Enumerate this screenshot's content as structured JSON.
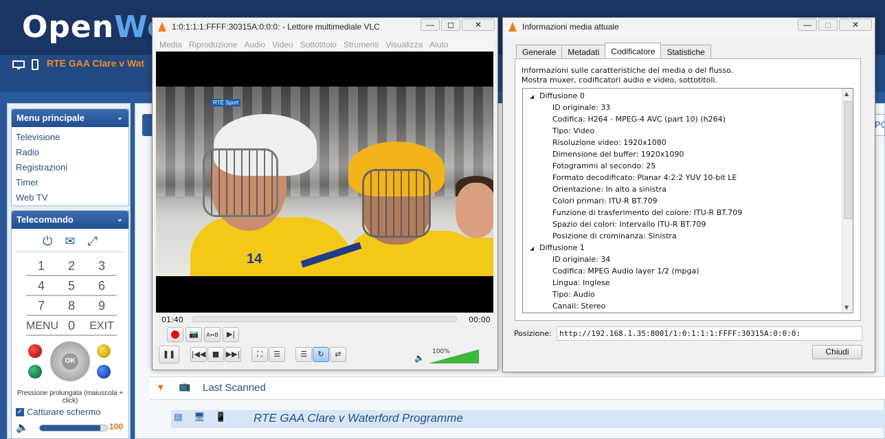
{
  "openwebif": {
    "logo_a": "Open",
    "logo_b": "We",
    "now_playing": "RTE GAA Clare v Wat",
    "menu_title": "Menu principale",
    "menu_items": [
      "Televisione",
      "Radio",
      "Registrazioni",
      "Timer",
      "Web TV"
    ],
    "remote_title": "Telecomando",
    "keypad": [
      "1",
      "2",
      "3",
      "4",
      "5",
      "6",
      "7",
      "8",
      "9",
      "MENU",
      "0",
      "EXIT"
    ],
    "ok_label": "OK",
    "hint": "Pressione prolungata (maiuscola + click)",
    "capture_label": "Catturare schermo",
    "volume_value": "100",
    "volume_fraction": 0.9,
    "tab_stub_text": "PO",
    "last_scanned": "Last Scanned",
    "programme": "RTE GAA Clare v Waterford Programme"
  },
  "vlc": {
    "title": "1:0:1:1:1:FFFF:30315A:0:0:0: - Lettore multimediale VLC",
    "menu": [
      "Media",
      "Riproduzione",
      "Audio",
      "Video",
      "Sottotitolo",
      "Strumenti",
      "Visualizza",
      "Aiuto"
    ],
    "video_logo": "RTÉ Sport",
    "jersey_number": "14",
    "time_elapsed": "01:40",
    "time_total": "00:00",
    "volume": "100%",
    "volume_fraction": 1.0
  },
  "info": {
    "title": "Informazioni media attuale",
    "tabs": [
      "Generale",
      "Metadati",
      "Codificatore",
      "Statistiche"
    ],
    "active_tab": "Codificatore",
    "desc_line1": "Informazioni sulle caratteristiche del media o del flusso.",
    "desc_line2": "Mostra muxer, codificatori audio e video, sottotitoli.",
    "streams": [
      {
        "name": "Diffusione 0",
        "props": [
          "ID originale: 33",
          "Codifica: H264 - MPEG-4 AVC (part 10) (h264)",
          "Tipo: Video",
          "Risoluzione video: 1920x1080",
          "Dimensione del buffer: 1920x1090",
          "Fotogrammi al secondo: 25",
          "Formato decodificato: Planar 4:2:2 YUV 10-bit LE",
          "Orientazione: In alto a sinistra",
          "Colori primari: ITU-R BT.709",
          "Funzione di trasferimento del colore: ITU-R BT.709",
          "Spazio dei colori: Intervallo ITU-R BT.709",
          "Posizione di crominanza: Sinistra"
        ]
      },
      {
        "name": "Diffusione 1",
        "props": [
          "ID originale: 34",
          "Codifica: MPEG Audio layer 1/2 (mpga)",
          "Lingua: Inglese",
          "Tipo: Audio",
          "Canali: Stereo"
        ]
      }
    ],
    "position_label": "Posizione:",
    "position_value": "http://192.168.1.35:8001/1:0:1:1:1:FFFF:30315A:0:0:0:",
    "close_label": "Chiudi"
  },
  "colors": {
    "header": "#1b3564",
    "accent_orange": "#f08a2a",
    "vlc_cone": "#f08020"
  }
}
